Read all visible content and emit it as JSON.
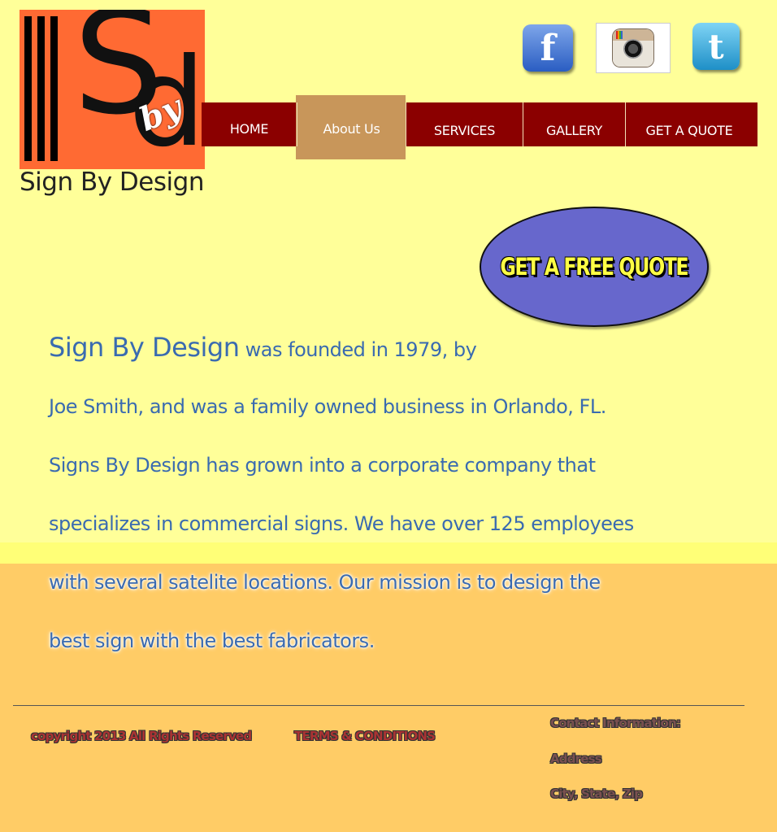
{
  "logo": {
    "name": "Sign By Design",
    "letters": [
      "S",
      "by",
      "d"
    ]
  },
  "social": [
    {
      "name": "facebook",
      "icon": "facebook-icon",
      "glyph": "f"
    },
    {
      "name": "instagram",
      "icon": "instagram-icon"
    },
    {
      "name": "twitter",
      "icon": "twitter-icon",
      "glyph": "t"
    }
  ],
  "nav": {
    "items": [
      {
        "label": "HOME"
      },
      {
        "label": "About Us",
        "active": true
      },
      {
        "label": "SERVICES"
      },
      {
        "label": "GALLERY"
      },
      {
        "label": "GET A QUOTE"
      }
    ]
  },
  "cta": {
    "label": "GET A FREE QUOTE"
  },
  "about": {
    "brand": "Sign By Design",
    "line1_rest": " was founded in 1979, by",
    "line2": "Joe Smith, and was a family owned business in Orlando, FL.",
    "line3": "Signs By Design has grown into a corporate company that",
    "line4": "specializes in commercial signs.  We have over 125 employees",
    "line5": "with several satelite locations.  Our mission is to design the",
    "line6": "best sign with the best fabricators."
  },
  "footer": {
    "copyright": "copyright 2013 All Rights Reserved",
    "terms": "TERMS & CONDITIONS",
    "contact_heading": "Contact Information:",
    "address": "Address",
    "city": "City, State, Zip"
  },
  "colors": {
    "background": "#ffff99",
    "band": "#ffcc66",
    "nav": "#8b0000",
    "nav_active": "#c8965a",
    "logo": "#ff6a33",
    "cta": "#6767cc",
    "text": "#3a6bb0"
  }
}
